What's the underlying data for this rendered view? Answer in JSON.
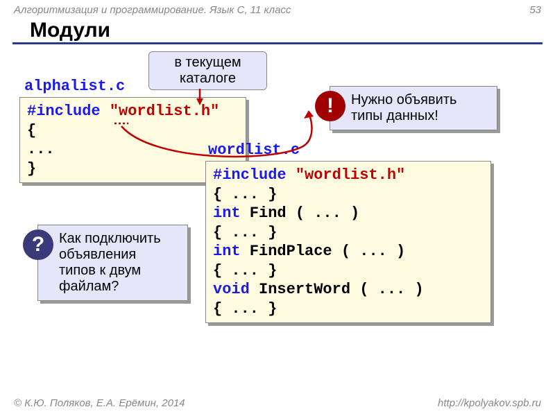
{
  "header": {
    "course": "Алгоритмизация и программирование. Язык С, 11 класс",
    "page": "53"
  },
  "title": "Модули",
  "file1_name": "alphalist.c",
  "file2_name": "wordlist.c",
  "dir_callout_l1": "в текущем",
  "dir_callout_l2": "каталоге",
  "code1": {
    "include_kw": "#include",
    "include_arg": "\"wordlist.h\"",
    "brace_open": "{",
    "body": "  ...",
    "brace_close": "}"
  },
  "code2": {
    "include_kw": "#include",
    "include_arg": "\"wordlist.h\"",
    "l1": "{ ... }",
    "l2a": "int",
    "l2b": " Find ( ... )",
    "l3": "{ ... }",
    "l4a": "int",
    "l4b": " FindPlace ( ... )",
    "l5": "{ ... }",
    "l6a": "void",
    "l6b": " InsertWord ( ... )",
    "l7": "{ ... }"
  },
  "note_exclaim_l1": "Нужно объявить",
  "note_exclaim_l2": "типы данных!",
  "note_question_l1": "Как подключить",
  "note_question_l2": "объявления",
  "note_question_l3": "типов к двум",
  "note_question_l4": "файлам?",
  "badge_exclaim": "!",
  "badge_question": "?",
  "footer": {
    "copyright": "© К.Ю. Поляков, Е.А. Ерёмин, 2014",
    "url": "http://kpolyakov.spb.ru"
  }
}
